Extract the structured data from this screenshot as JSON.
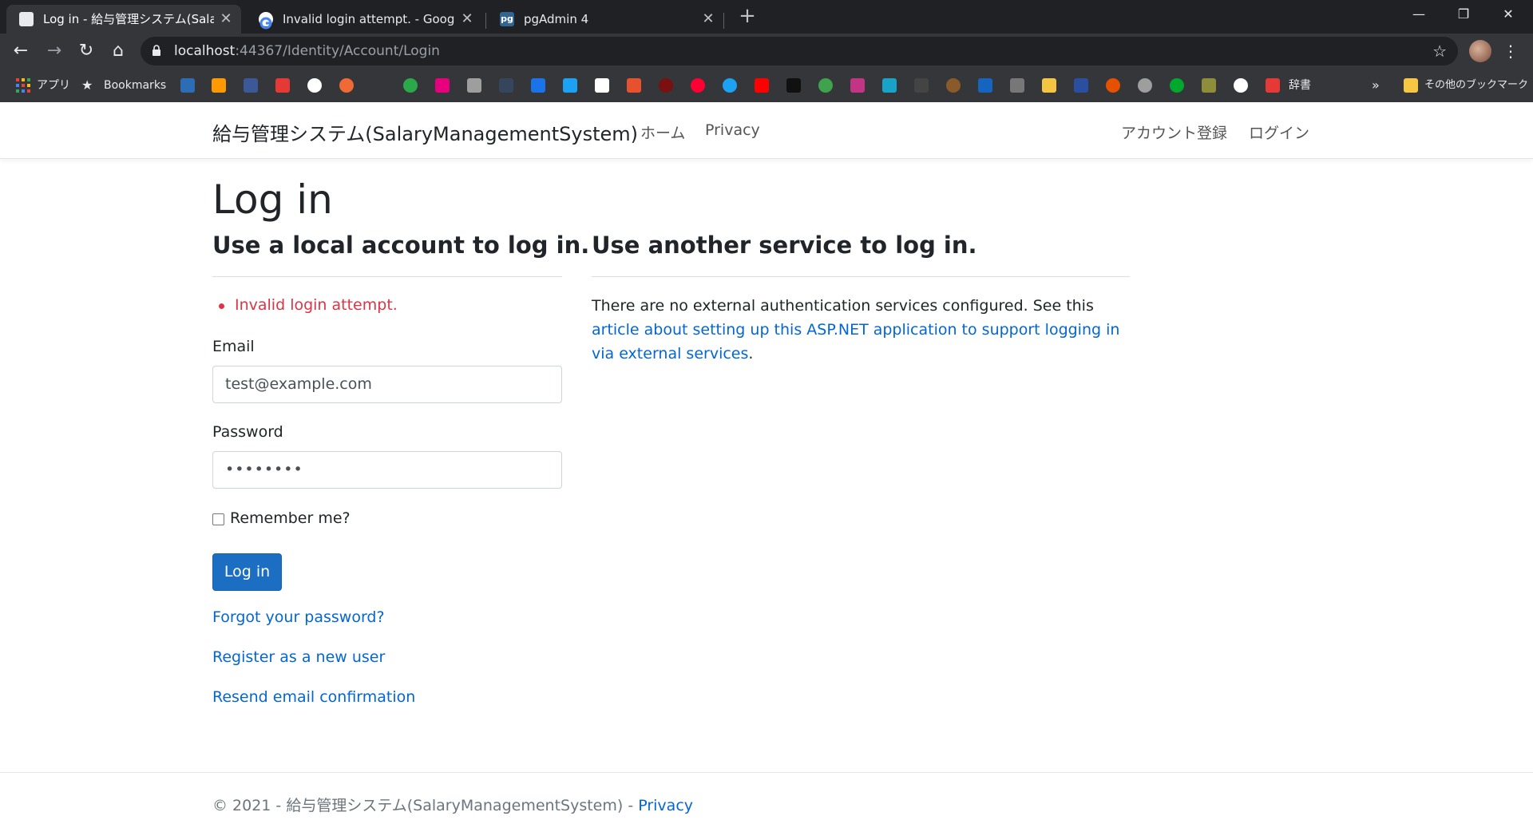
{
  "browser": {
    "tabs": [
      {
        "title": "Log in - 給与管理システム(SalaryM",
        "favicon": "document-icon",
        "active": true
      },
      {
        "title": "Invalid login attempt. - Google 検",
        "favicon": "google-icon",
        "active": false
      },
      {
        "title": "pgAdmin 4",
        "favicon": "pgadmin-icon",
        "active": false
      }
    ],
    "new_tab": "+",
    "window_controls": {
      "minimize": "—",
      "restore": "❐",
      "close": "✕"
    },
    "nav": {
      "back": "←",
      "forward": "→",
      "reload": "↻",
      "home": "⌂"
    },
    "url_host": "localhost",
    "url_rest": ":44367/Identity/Account/Login",
    "bookmarks_bar": {
      "apps_label": "アプリ",
      "bookmarks_label": "Bookmarks",
      "dictionary_label": "辞書",
      "overflow": "»",
      "other_label": "その他のブックマーク"
    }
  },
  "site": {
    "brand": "給与管理システム(SalaryManagementSystem)",
    "nav": {
      "home": "ホーム",
      "privacy": "Privacy",
      "register": "アカウント登録",
      "login": "ログイン"
    }
  },
  "login": {
    "title": "Log in",
    "local_heading": "Use a local account to log in.",
    "error": "Invalid login attempt.",
    "email_label": "Email",
    "email_value": "test@example.com",
    "password_label": "Password",
    "password_value": "••••••••",
    "remember_label": "Remember me?",
    "submit_label": "Log in",
    "forgot_link": "Forgot your password?",
    "register_link": "Register as a new user",
    "resend_link": "Resend email confirmation"
  },
  "external": {
    "heading": "Use another service to log in.",
    "text_before": "There are no external authentication services configured. See this ",
    "link_text": "article about setting up this ASP.NET application to support logging in via external services",
    "text_after": "."
  },
  "footer": {
    "text": "© 2021 - 給与管理システム(SalaryManagementSystem) - ",
    "privacy": "Privacy"
  },
  "colors": {
    "link": "#0366d6",
    "error": "#dc3545",
    "primary_button": "#1b6ec2",
    "chrome_dark": "#202124",
    "chrome_toolbar": "#35363a"
  }
}
